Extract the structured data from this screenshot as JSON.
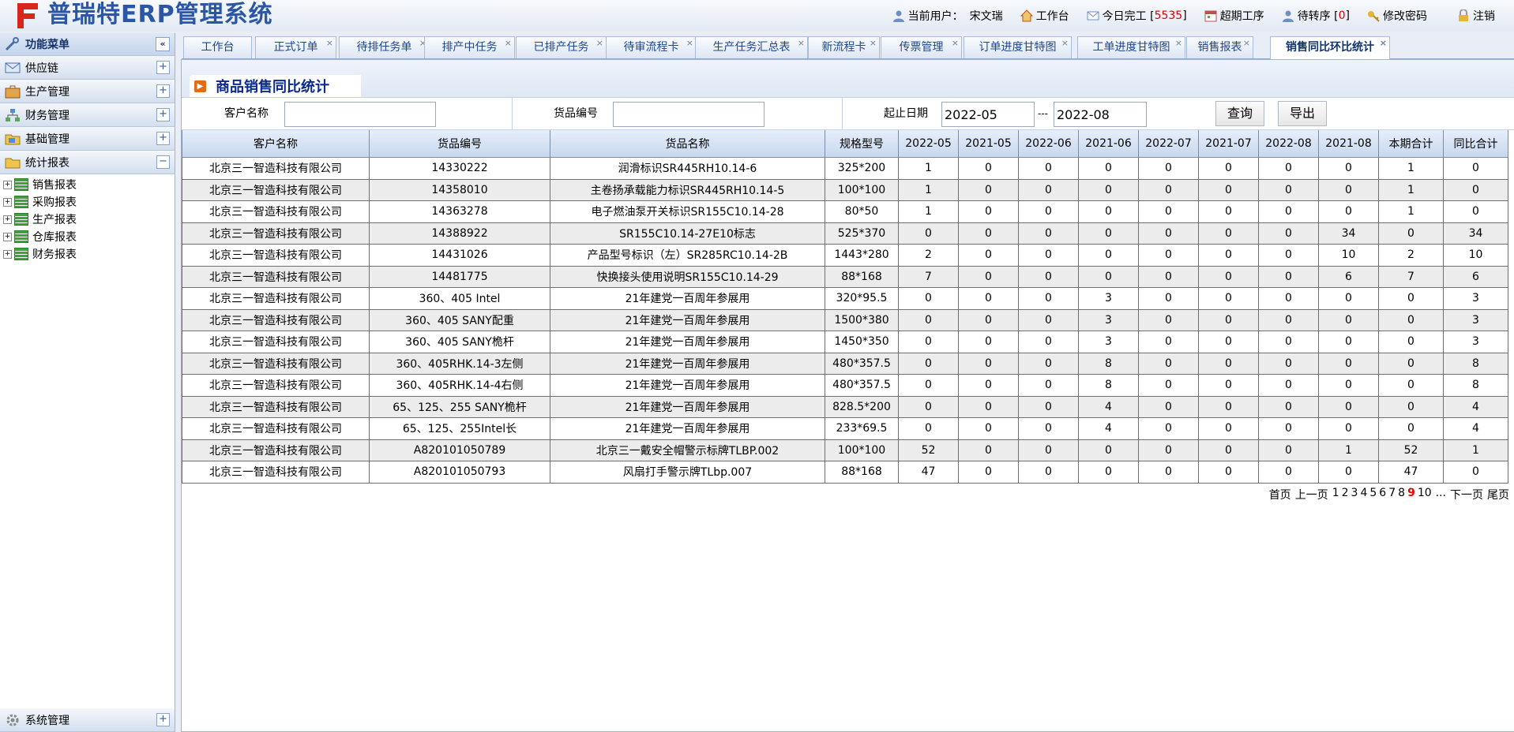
{
  "app": {
    "title": "普瑞特ERP管理系统"
  },
  "topnav": {
    "user_label": "当前用户：",
    "user_name": "宋文瑞",
    "workbench": "工作台",
    "done_today_label": "今日完工 [",
    "done_today_count": "5535",
    "done_today_close": "]",
    "overdue": "超期工序",
    "pending_transfer_label": "待转序 [",
    "pending_transfer_count": "0",
    "pending_transfer_close": "]",
    "change_password": "修改密码",
    "logout": "注销"
  },
  "sidebar": {
    "title": "功能菜单",
    "collapse_symbol": "«",
    "sections": [
      "供应链",
      "生产管理",
      "财务管理",
      "基础管理",
      "统计报表"
    ],
    "expand_symbol": "+",
    "collapse_section_symbol": "−",
    "reports": [
      "销售报表",
      "采购报表",
      "生产报表",
      "仓库报表",
      "财务报表"
    ],
    "system": "系统管理"
  },
  "tabs": [
    "工作台",
    "正式订单",
    "待排任务单",
    "排产中任务",
    "已排产任务",
    "待审流程卡",
    "生产任务汇总表",
    "新流程卡",
    "传票管理",
    "订单进度甘特图",
    "工单进度甘特图",
    "销售报表",
    "销售同比环比统计"
  ],
  "tab_close_symbol": "×",
  "panel": {
    "title": "商品销售同比统计"
  },
  "filters": {
    "customer_label": "客户名称",
    "customer_value": "",
    "item_label": "货品编号",
    "item_value": "",
    "date_label": "起止日期",
    "date_from": "2022-05",
    "date_sep": "---",
    "date_to": "2022-08",
    "query_button": "查询",
    "export_button": "导出"
  },
  "table": {
    "columns": [
      "客户名称",
      "货品编号",
      "货品名称",
      "规格型号",
      "2022-05",
      "2021-05",
      "2022-06",
      "2021-06",
      "2022-07",
      "2021-07",
      "2022-08",
      "2021-08",
      "本期合计",
      "同比合计"
    ],
    "rows": [
      [
        "北京三一智造科技有限公司",
        "14330222",
        "润滑标识SR445RH10.14-6",
        "325*200",
        "1",
        "0",
        "0",
        "0",
        "0",
        "0",
        "0",
        "0",
        "1",
        "0"
      ],
      [
        "北京三一智造科技有限公司",
        "14358010",
        "主卷扬承载能力标识SR445RH10.14-5",
        "100*100",
        "1",
        "0",
        "0",
        "0",
        "0",
        "0",
        "0",
        "0",
        "1",
        "0"
      ],
      [
        "北京三一智造科技有限公司",
        "14363278",
        "电子燃油泵开关标识SR155C10.14-28",
        "80*50",
        "1",
        "0",
        "0",
        "0",
        "0",
        "0",
        "0",
        "0",
        "1",
        "0"
      ],
      [
        "北京三一智造科技有限公司",
        "14388922",
        "SR155C10.14-27E10标志",
        "525*370",
        "0",
        "0",
        "0",
        "0",
        "0",
        "0",
        "0",
        "34",
        "0",
        "34"
      ],
      [
        "北京三一智造科技有限公司",
        "14431026",
        "产品型号标识（左）SR285RC10.14-2B",
        "1443*280",
        "2",
        "0",
        "0",
        "0",
        "0",
        "0",
        "0",
        "10",
        "2",
        "10"
      ],
      [
        "北京三一智造科技有限公司",
        "14481775",
        "快换接头使用说明SR155C10.14-29",
        "88*168",
        "7",
        "0",
        "0",
        "0",
        "0",
        "0",
        "0",
        "6",
        "7",
        "6"
      ],
      [
        "北京三一智造科技有限公司",
        "360、405 Intel",
        "21年建党一百周年参展用",
        "320*95.5",
        "0",
        "0",
        "0",
        "3",
        "0",
        "0",
        "0",
        "0",
        "0",
        "3"
      ],
      [
        "北京三一智造科技有限公司",
        "360、405 SANY配重",
        "21年建党一百周年参展用",
        "1500*380",
        "0",
        "0",
        "0",
        "3",
        "0",
        "0",
        "0",
        "0",
        "0",
        "3"
      ],
      [
        "北京三一智造科技有限公司",
        "360、405 SANY桅杆",
        "21年建党一百周年参展用",
        "1450*350",
        "0",
        "0",
        "0",
        "3",
        "0",
        "0",
        "0",
        "0",
        "0",
        "3"
      ],
      [
        "北京三一智造科技有限公司",
        "360、405RHK.14-3左侧",
        "21年建党一百周年参展用",
        "480*357.5",
        "0",
        "0",
        "0",
        "8",
        "0",
        "0",
        "0",
        "0",
        "0",
        "8"
      ],
      [
        "北京三一智造科技有限公司",
        "360、405RHK.14-4右侧",
        "21年建党一百周年参展用",
        "480*357.5",
        "0",
        "0",
        "0",
        "8",
        "0",
        "0",
        "0",
        "0",
        "0",
        "8"
      ],
      [
        "北京三一智造科技有限公司",
        "65、125、255 SANY桅杆",
        "21年建党一百周年参展用",
        "828.5*200",
        "0",
        "0",
        "0",
        "4",
        "0",
        "0",
        "0",
        "0",
        "0",
        "4"
      ],
      [
        "北京三一智造科技有限公司",
        "65、125、255Intel长",
        "21年建党一百周年参展用",
        "233*69.5",
        "0",
        "0",
        "0",
        "4",
        "0",
        "0",
        "0",
        "0",
        "0",
        "4"
      ],
      [
        "北京三一智造科技有限公司",
        "A820101050789",
        "北京三一戴安全帽警示标牌TLBP.002",
        "100*100",
        "52",
        "0",
        "0",
        "0",
        "0",
        "0",
        "0",
        "1",
        "52",
        "1"
      ],
      [
        "北京三一智造科技有限公司",
        "A820101050793",
        "风扇打手警示牌TLbp.007",
        "88*168",
        "47",
        "0",
        "0",
        "0",
        "0",
        "0",
        "0",
        "0",
        "47",
        "0"
      ]
    ]
  },
  "pager": {
    "first": "首页",
    "prev": "上一页",
    "pages": [
      "1",
      "2",
      "3",
      "4",
      "5",
      "6",
      "7",
      "8",
      "9",
      "10"
    ],
    "current": "9",
    "ellipsis": "...",
    "next": "下一页",
    "last": "尾页"
  },
  "colors": {
    "brand": "#2b56a6",
    "accent_red": "#dd0000",
    "logo_red": "#d9261c"
  }
}
